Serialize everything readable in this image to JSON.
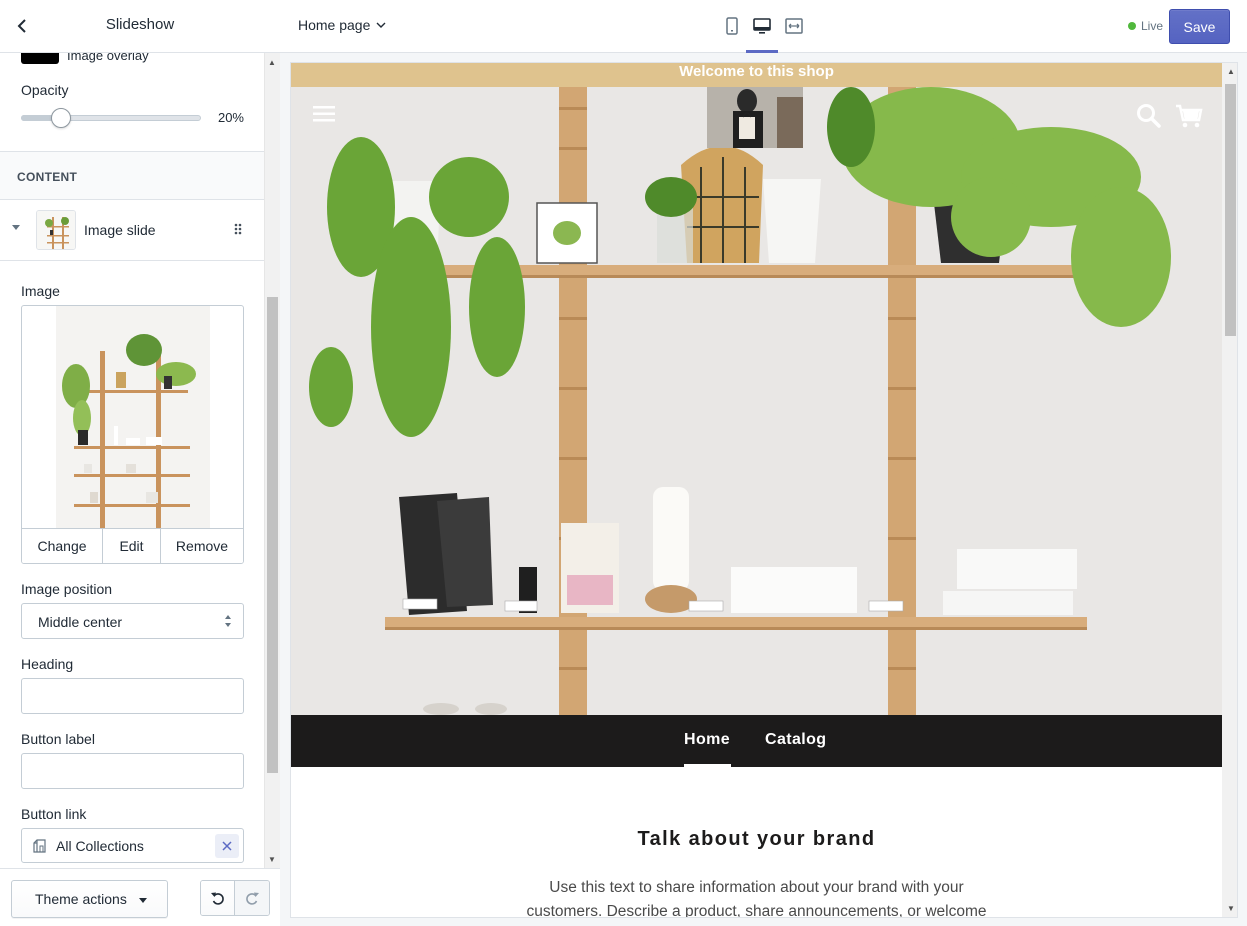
{
  "sidebar": {
    "title": "Slideshow",
    "overlay_label": "Image overlay",
    "opacity": {
      "label": "Opacity",
      "value_text": "20%",
      "value": 0.2
    },
    "content_section_label": "CONTENT",
    "slide_label": "Image slide",
    "image_label": "Image",
    "image_actions": [
      "Change",
      "Edit",
      "Remove"
    ],
    "image_position": {
      "label": "Image position",
      "value": "Middle center"
    },
    "heading": {
      "label": "Heading",
      "value": ""
    },
    "button_label": {
      "label": "Button label",
      "value": ""
    },
    "button_link": {
      "label": "Button link",
      "value": "All Collections"
    },
    "footer": {
      "theme_actions": "Theme actions"
    }
  },
  "topbar": {
    "page_select": "Home page",
    "status": "Live",
    "save": "Save"
  },
  "preview": {
    "announcement": "Welcome to this shop",
    "nav": [
      "Home",
      "Catalog"
    ],
    "brand_heading": "Talk about your brand",
    "brand_text": "Use this text to share information about your brand with your customers. Describe a product, share announcements, or welcome"
  },
  "colors": {
    "accent": "#5c6ac4",
    "live_dot": "#50b83c",
    "announcement_bg": "#dfc38e",
    "nav_bg": "#1c1b1b"
  },
  "icons": {
    "back": "chevron-left-icon",
    "page_select": "chevron-down-icon",
    "views": [
      "mobile-icon",
      "desktop-icon",
      "fullwidth-icon"
    ],
    "undo": "undo-icon",
    "redo": "redo-icon",
    "link": "collection-icon",
    "clear": "close-icon",
    "menu": "hamburger-icon",
    "search": "search-icon",
    "cart": "cart-icon"
  }
}
